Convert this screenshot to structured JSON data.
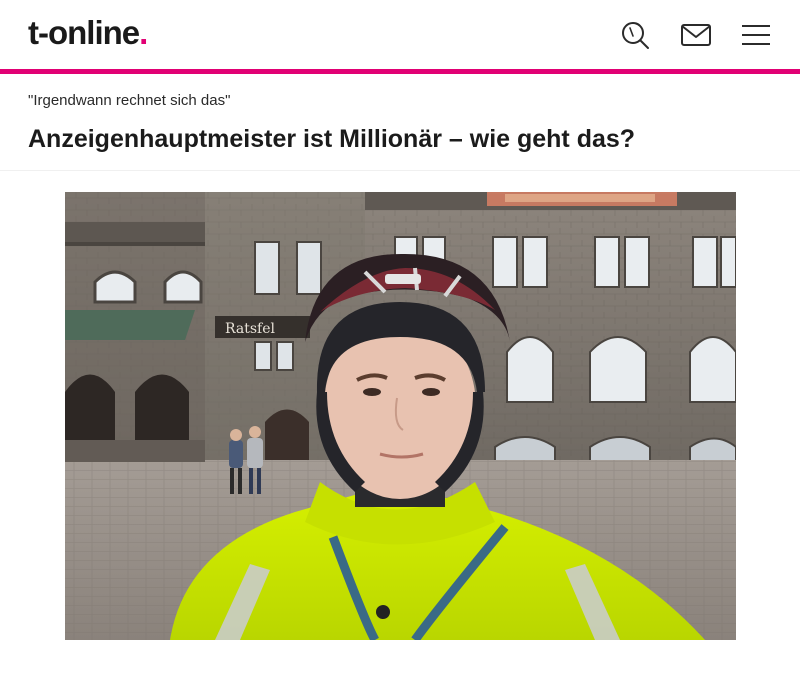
{
  "header": {
    "logo_text": "t-online",
    "logo_dot": ".",
    "search_icon": "search-icon",
    "mail_icon": "mail-icon",
    "menu_icon": "hamburger-menu-icon",
    "accent_color": "#e10074"
  },
  "article": {
    "kicker": "\"Irgendwann rechnet sich das\"",
    "headline": "Anzeigenhauptmeister ist Millionär – wie geht das?"
  },
  "image": {
    "sign_text": "Ratsfel"
  }
}
